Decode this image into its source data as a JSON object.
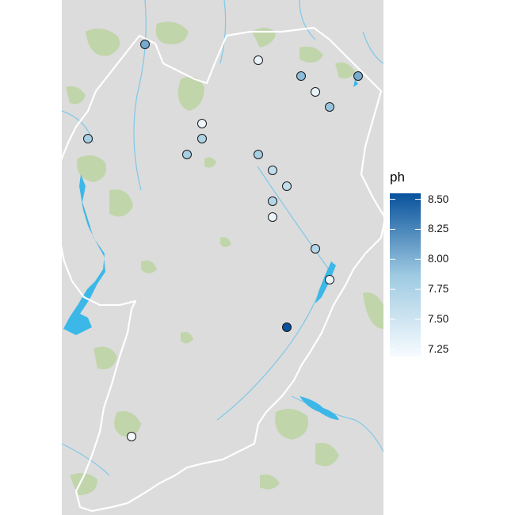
{
  "legend": {
    "title": "ph",
    "ticks": [
      {
        "label": "8.50",
        "value": 8.5
      },
      {
        "label": "8.25",
        "value": 8.25
      },
      {
        "label": "8.00",
        "value": 8.0
      },
      {
        "label": "7.75",
        "value": 7.75
      },
      {
        "label": "7.50",
        "value": 7.5
      },
      {
        "label": "7.25",
        "value": 7.25
      }
    ],
    "range": [
      7.19,
      8.55
    ],
    "color_low": "#f7fbff",
    "color_high": "#08519c"
  },
  "colors": {
    "background": "#dcdcdc",
    "vegetation": "#b8d39a",
    "water": "#3bb8e8",
    "river": "#7fc8e8",
    "boundary": "#ffffff"
  },
  "sites": [
    {
      "id": "site-1",
      "ph": 8.05
    },
    {
      "id": "site-2",
      "ph": 7.3
    },
    {
      "id": "site-3",
      "ph": 7.95
    },
    {
      "id": "site-4",
      "ph": 8.05
    },
    {
      "id": "site-5",
      "ph": 7.3
    },
    {
      "id": "site-6",
      "ph": 7.9
    },
    {
      "id": "site-7",
      "ph": 7.25
    },
    {
      "id": "site-8",
      "ph": 7.75
    },
    {
      "id": "site-9",
      "ph": 7.8
    },
    {
      "id": "site-10",
      "ph": 7.8
    },
    {
      "id": "site-11",
      "ph": 7.8
    },
    {
      "id": "site-12",
      "ph": 7.6
    },
    {
      "id": "site-13",
      "ph": 7.6
    },
    {
      "id": "site-14",
      "ph": 7.7
    },
    {
      "id": "site-15",
      "ph": 7.3
    },
    {
      "id": "site-16",
      "ph": 7.7
    },
    {
      "id": "site-17",
      "ph": 7.3
    },
    {
      "id": "site-18",
      "ph": 7.2
    },
    {
      "id": "site-19",
      "ph": 8.55
    },
    {
      "id": "site-20",
      "ph": 7.25
    }
  ]
}
